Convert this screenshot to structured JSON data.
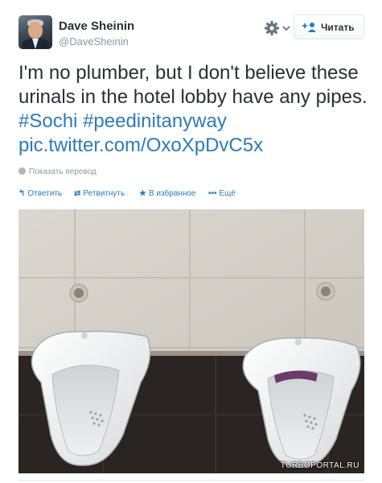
{
  "author": {
    "display_name": "Dave Sheinin",
    "handle": "@DaveSheinin"
  },
  "header": {
    "follow_label": "Читать",
    "gear_icon": "gear-icon",
    "follow_icon": "add-user-icon"
  },
  "tweet": {
    "text_before": "I'm no plumber, but I don't believe these urinals in the hotel lobby have any pipes. ",
    "hashtag_1": "#Sochi",
    "hashtag_2": "#peedinitanyway",
    "link": "pic.twitter.com/OxoXpDvC5x",
    "translate_label": "Показать перевод"
  },
  "actions": {
    "reply": "Ответить",
    "retweet": "Ретвитнуть",
    "favorite": "В избранное",
    "more": "Ещё"
  },
  "photo": {
    "watermark": "TURBOPORTAL.RU"
  },
  "colors": {
    "link": "#2b7bb9",
    "text": "#292f33",
    "muted": "#8899a6"
  }
}
